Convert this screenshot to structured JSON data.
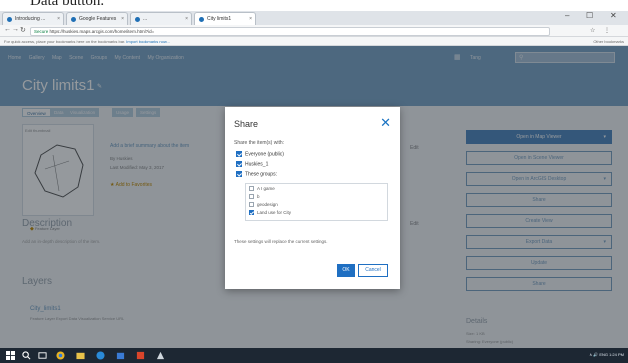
{
  "caption": {
    "text": "Data button."
  },
  "browser": {
    "tabs": [
      {
        "label": "Introducing ..."
      },
      {
        "label": "Google Features"
      },
      {
        "label": "..."
      },
      {
        "label": "City limits1"
      }
    ],
    "window_controls": {
      "minimize": "–",
      "maximize": "☐",
      "close": "✕"
    },
    "url": {
      "secure_label": "Secure",
      "value": "https://huskies.maps.arcgis.com/home/item.html?id="
    },
    "bookmarks": {
      "text": "For quick access, place your bookmarks here on the bookmarks bar.",
      "link": "Import bookmarks now...",
      "other": "Other bookmarks"
    }
  },
  "portal": {
    "nav_items": [
      "Home",
      "Gallery",
      "Map",
      "Scene",
      "Groups",
      "My Content",
      "My Organization"
    ],
    "user_label": "Tang",
    "item_title": "City limits1",
    "item_tabs": [
      "Overview",
      "Data",
      "Visualization",
      "Usage",
      "Settings"
    ],
    "thumbnail_label": "Edit thumbnail",
    "thumb_footer": "Feature Layer",
    "summary_link": "Add a brief summary about the item",
    "meta_lines": [
      "By Huskies",
      "Last Modified: May 3, 2017"
    ],
    "favorites": "Add to Favorites",
    "edit_label": "Edit",
    "description_heading": "Description",
    "description_hint": "Add an in-depth description of the item.",
    "layers_heading": "Layers",
    "layer_name": "City_limits1",
    "layer_meta": "Feature Layer   Export Data   Visualization   Service URL",
    "actions": [
      {
        "label": "Open in Map Viewer",
        "primary": true,
        "caret": true
      },
      {
        "label": "Open in Scene Viewer",
        "primary": false,
        "caret": false
      },
      {
        "label": "Open in ArcGIS Desktop",
        "primary": false,
        "caret": true
      },
      {
        "label": "Share",
        "primary": false,
        "caret": false
      },
      {
        "label": "Create View",
        "primary": false,
        "caret": false
      },
      {
        "label": "Export Data",
        "primary": false,
        "caret": true
      },
      {
        "label": "Update",
        "primary": false,
        "caret": false
      },
      {
        "label": "Share",
        "primary": false,
        "caret": false
      }
    ],
    "details_heading": "Details",
    "details_lines": [
      "Size: 1 KB",
      "Sharing: Everyone (public)"
    ]
  },
  "share_dialog": {
    "title": "Share",
    "close_glyph": "✕",
    "prompt": "Share the item(s) with:",
    "options": [
      {
        "label": "Everyone (public)",
        "checked": true
      },
      {
        "label": "Huskies_1",
        "checked": true
      },
      {
        "label": "These groups:",
        "checked": true
      }
    ],
    "groups": [
      {
        "label": "A I game",
        "checked": false
      },
      {
        "label": "b",
        "checked": false
      },
      {
        "label": "geodesign",
        "checked": false
      },
      {
        "label": "Land use for City",
        "checked": true
      }
    ],
    "note": "These settings will replace the current settings.",
    "ok_label": "OK",
    "cancel_label": "Cancel"
  },
  "taskbar": {
    "tray_text": "∧  🔊  ENG  1:24 PM"
  },
  "colors": {
    "portal_blue": "#7da7c9",
    "accent": "#1f6fc2",
    "taskbar": "#1d2733"
  }
}
